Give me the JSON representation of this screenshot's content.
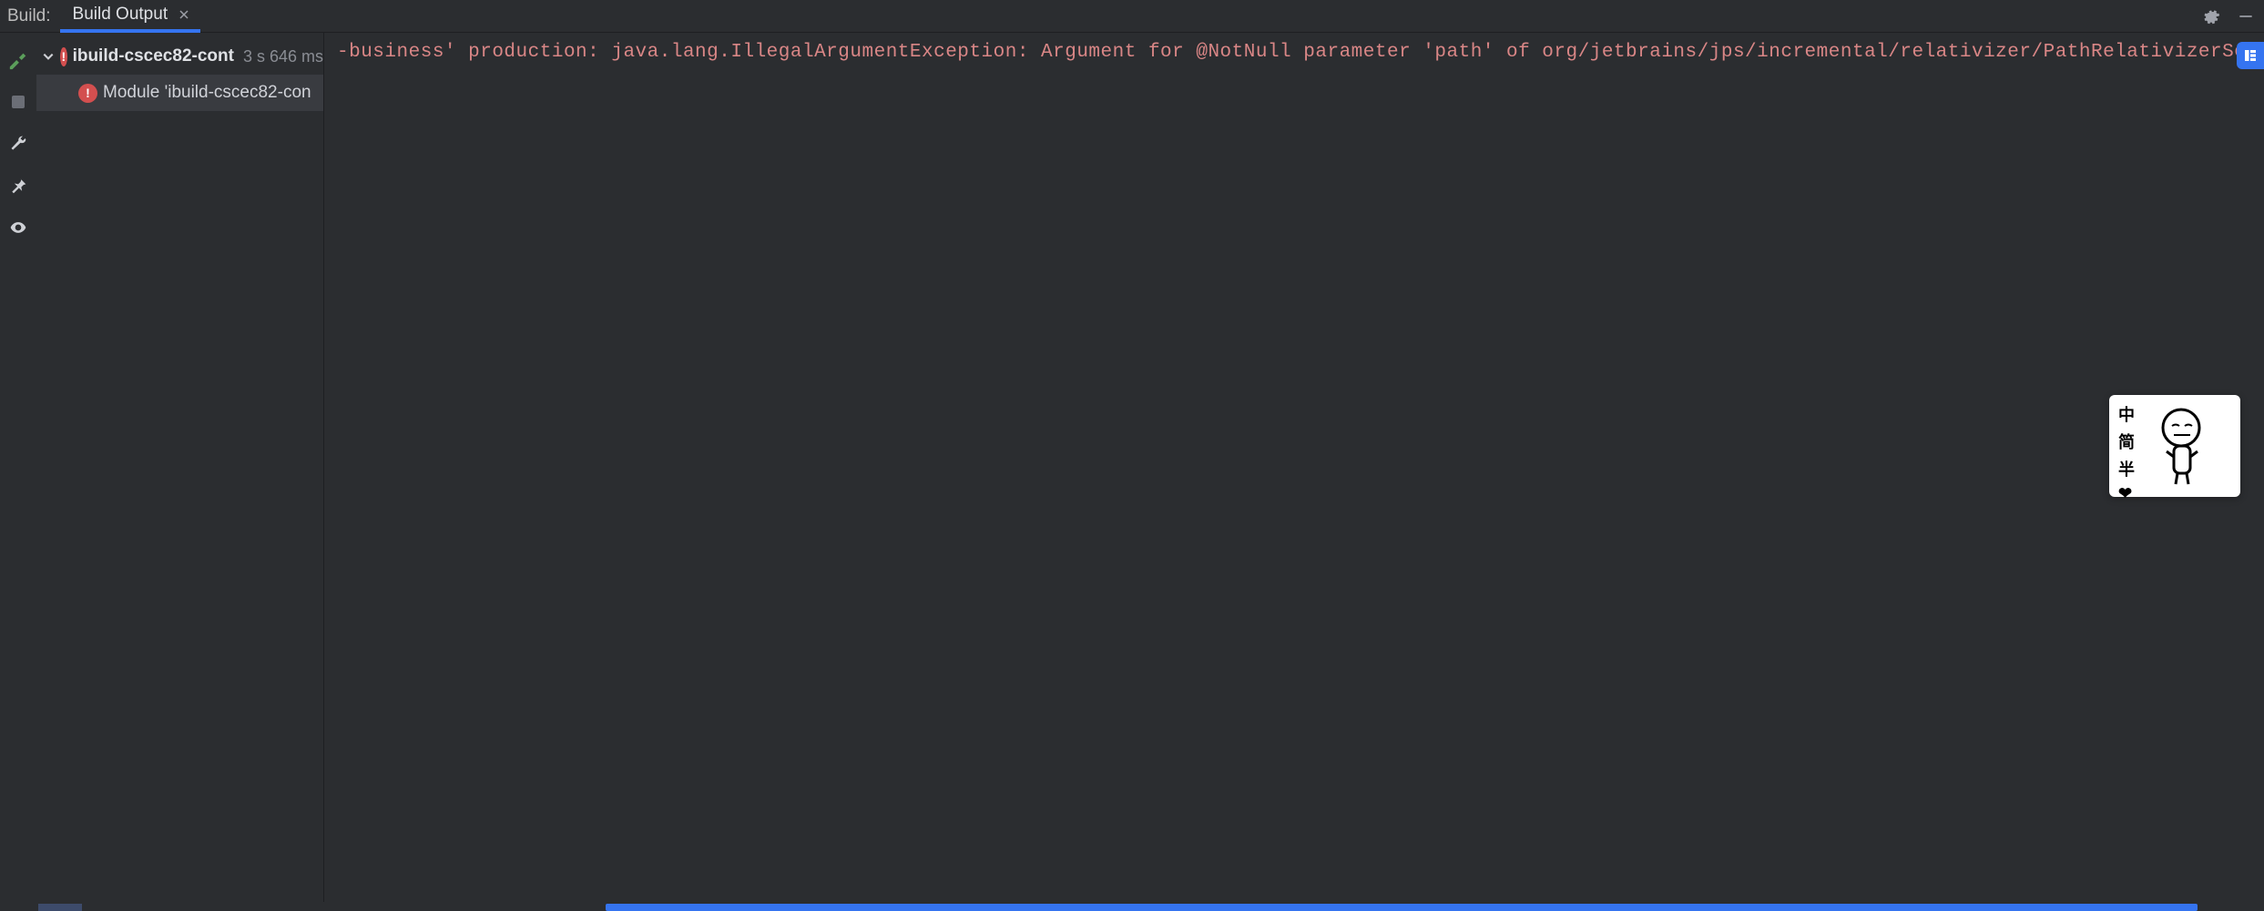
{
  "header": {
    "build_label": "Build:",
    "tab_label": "Build Output"
  },
  "tree": {
    "root": {
      "name": "ibuild-cscec82-cont",
      "duration": "3 s 646 ms"
    },
    "child": {
      "message": "Module 'ibuild-cscec82-con"
    }
  },
  "output": {
    "error_line": "-business' production: java.lang.IllegalArgumentException: Argument for @NotNull parameter 'path' of org/jetbrains/jps/incremental/relativizer/PathRelativizerService.toFull must not be nul"
  },
  "ime": {
    "c1": "中",
    "c2": "简",
    "c3": "半",
    "c4": "❤"
  }
}
